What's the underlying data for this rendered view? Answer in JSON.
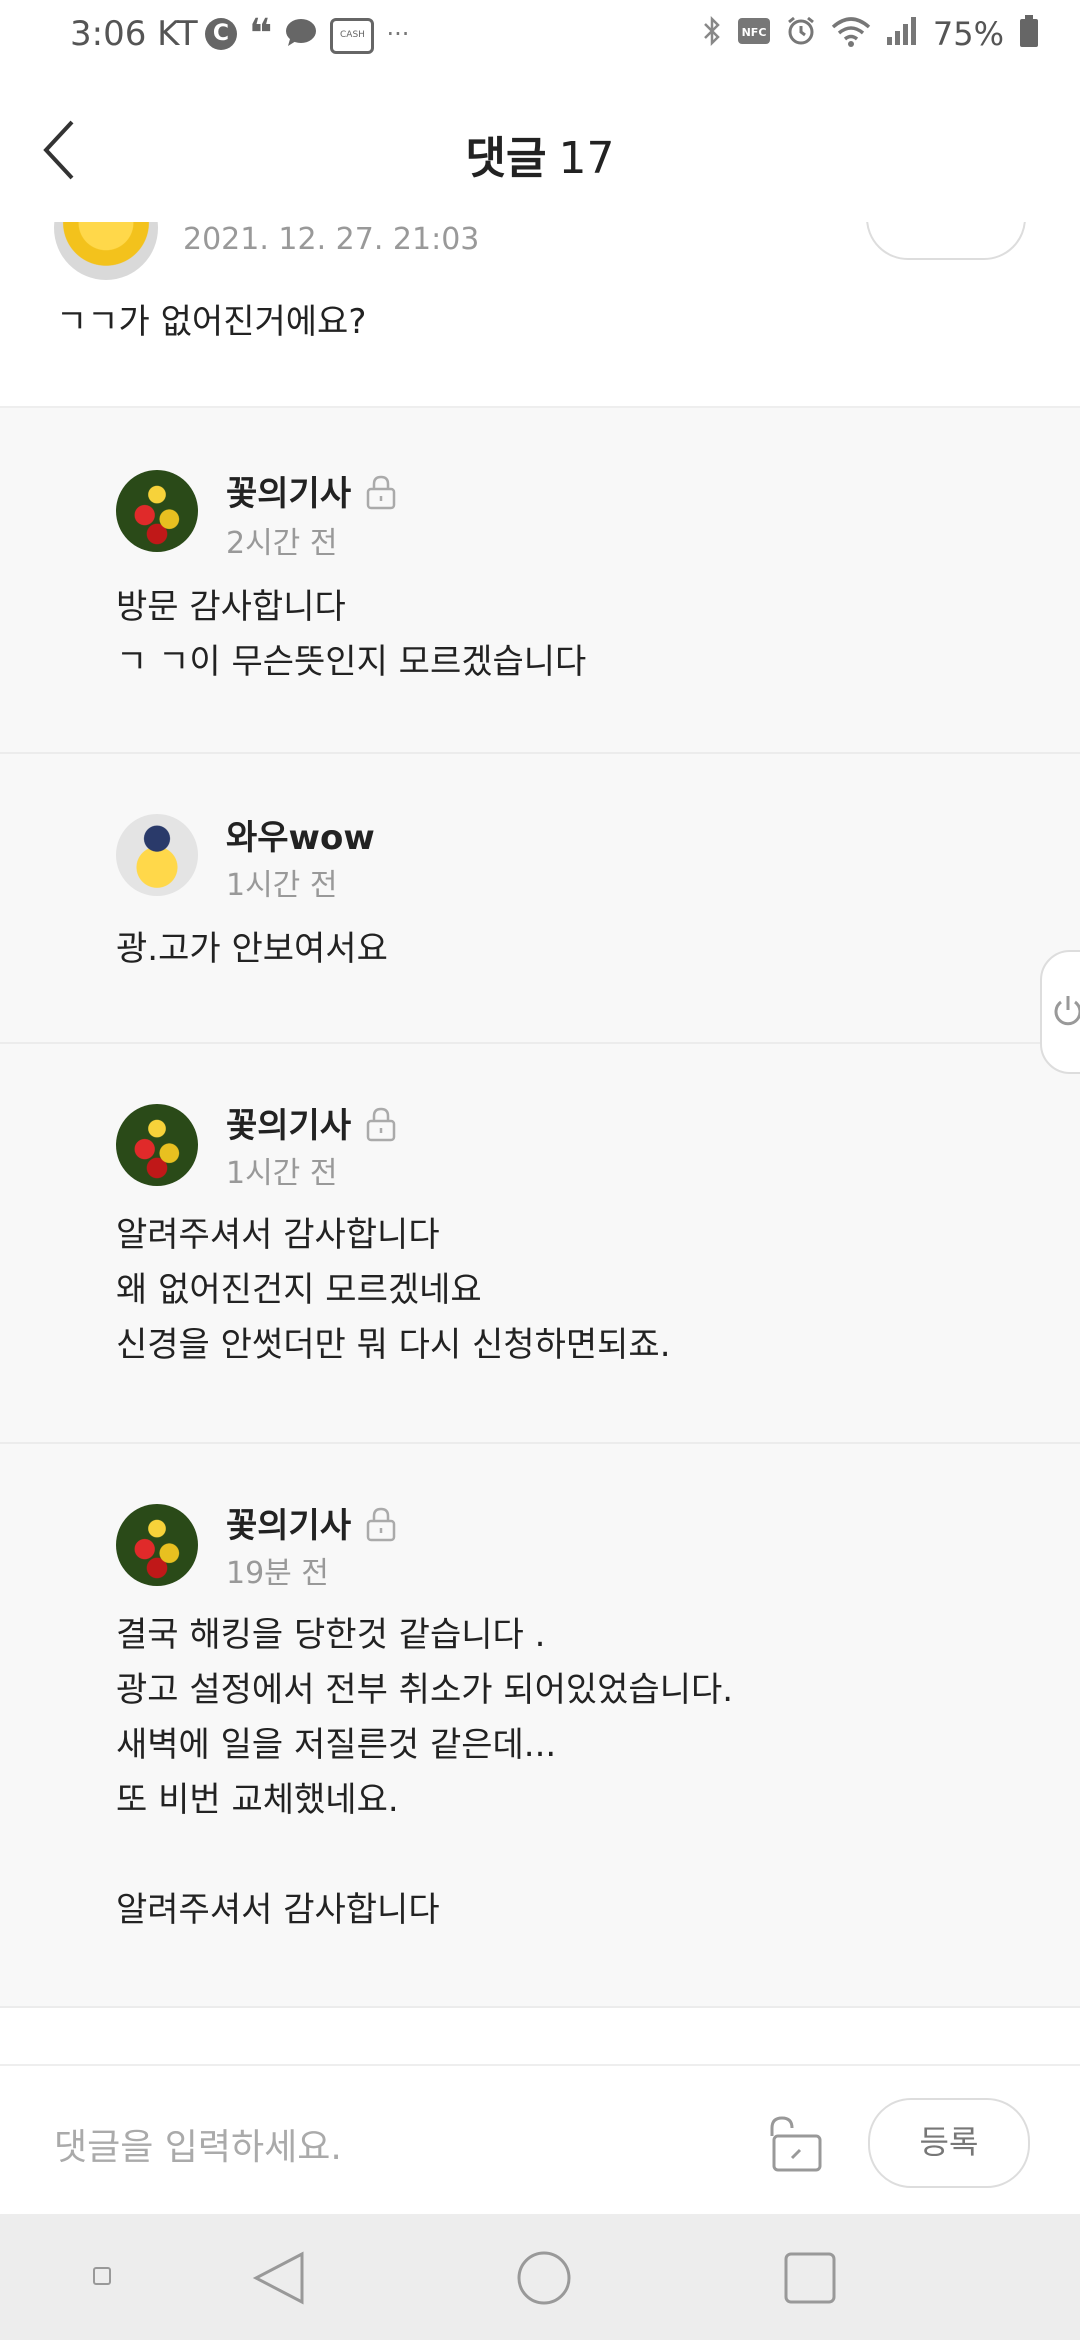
{
  "status_bar": {
    "time": "3:06",
    "carrier": "KT",
    "battery": "75%"
  },
  "header": {
    "title": "댓글",
    "count": "17"
  },
  "top_comment": {
    "date": "2021. 12. 27. 21:03",
    "body": "ㄱㄱ가 없어진거에요?"
  },
  "replies": [
    {
      "nickname": "꽃의기사",
      "time": "2시간 전",
      "body": "방문 감사합니다\nㄱ ㄱ이 무슨뜻인지 모르겠습니다"
    },
    {
      "nickname": "와우wow",
      "time": "1시간 전",
      "body": "광.고가 안보여서요"
    },
    {
      "nickname": "꽃의기사",
      "time": "1시간 전",
      "body": "알려주셔서 감사합니다\n왜 없어진건지 모르겠네요\n신경을 안썻더만 뭐 다시 신청하면되죠."
    },
    {
      "nickname": "꽃의기사",
      "time": "19분 전",
      "body": "결국 해킹을 당한것 같습니다 .\n광고 설정에서 전부 취소가 되어있었습니다.\n새벽에 일을 저질른것 같은데...\n또 비번 교체했네요.\n\n알려주셔서 감사합니다"
    }
  ],
  "input": {
    "placeholder": "댓글을 입력하세요.",
    "submit_label": "등록"
  },
  "icons": {
    "back": "chevron-left-icon",
    "lock": "lock-icon",
    "secret": "unlock-icon",
    "power": "power-icon"
  }
}
